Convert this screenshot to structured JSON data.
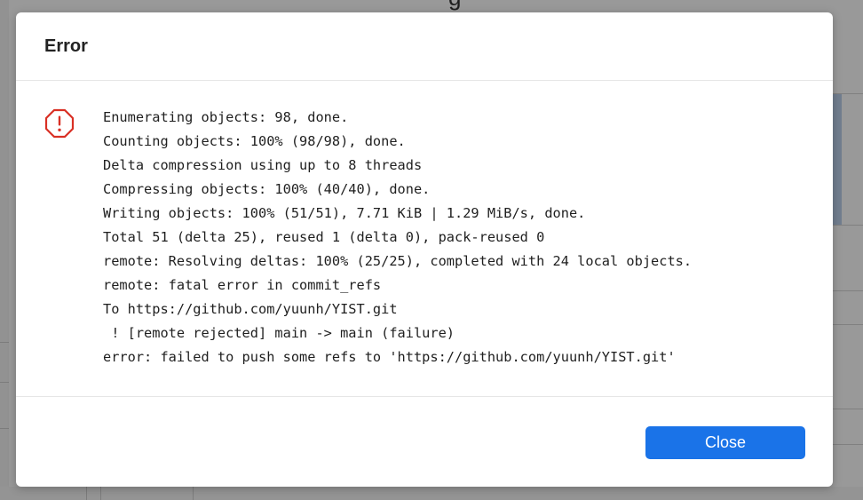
{
  "dialog": {
    "title": "Error",
    "icon": "error-octagon-icon",
    "log_lines": [
      "Enumerating objects: 98, done.",
      "Counting objects: 100% (98/98), done.",
      "Delta compression using up to 8 threads",
      "Compressing objects: 100% (40/40), done.",
      "Writing objects: 100% (51/51), 7.71 KiB | 1.29 MiB/s, done.",
      "Total 51 (delta 25), reused 1 (delta 0), pack-reused 0",
      "remote: Resolving deltas: 100% (25/25), completed with 24 local objects.",
      "remote: fatal error in commit_refs",
      "To https://github.com/yuunh/YIST.git",
      " ! [remote rejected] main -> main (failure)",
      "error: failed to push some refs to 'https://github.com/yuunh/YIST.git'"
    ],
    "close_label": "Close"
  },
  "colors": {
    "accent": "#1a73e8",
    "error": "#d93025",
    "overlay": "rgba(0,0,0,0.40)"
  }
}
